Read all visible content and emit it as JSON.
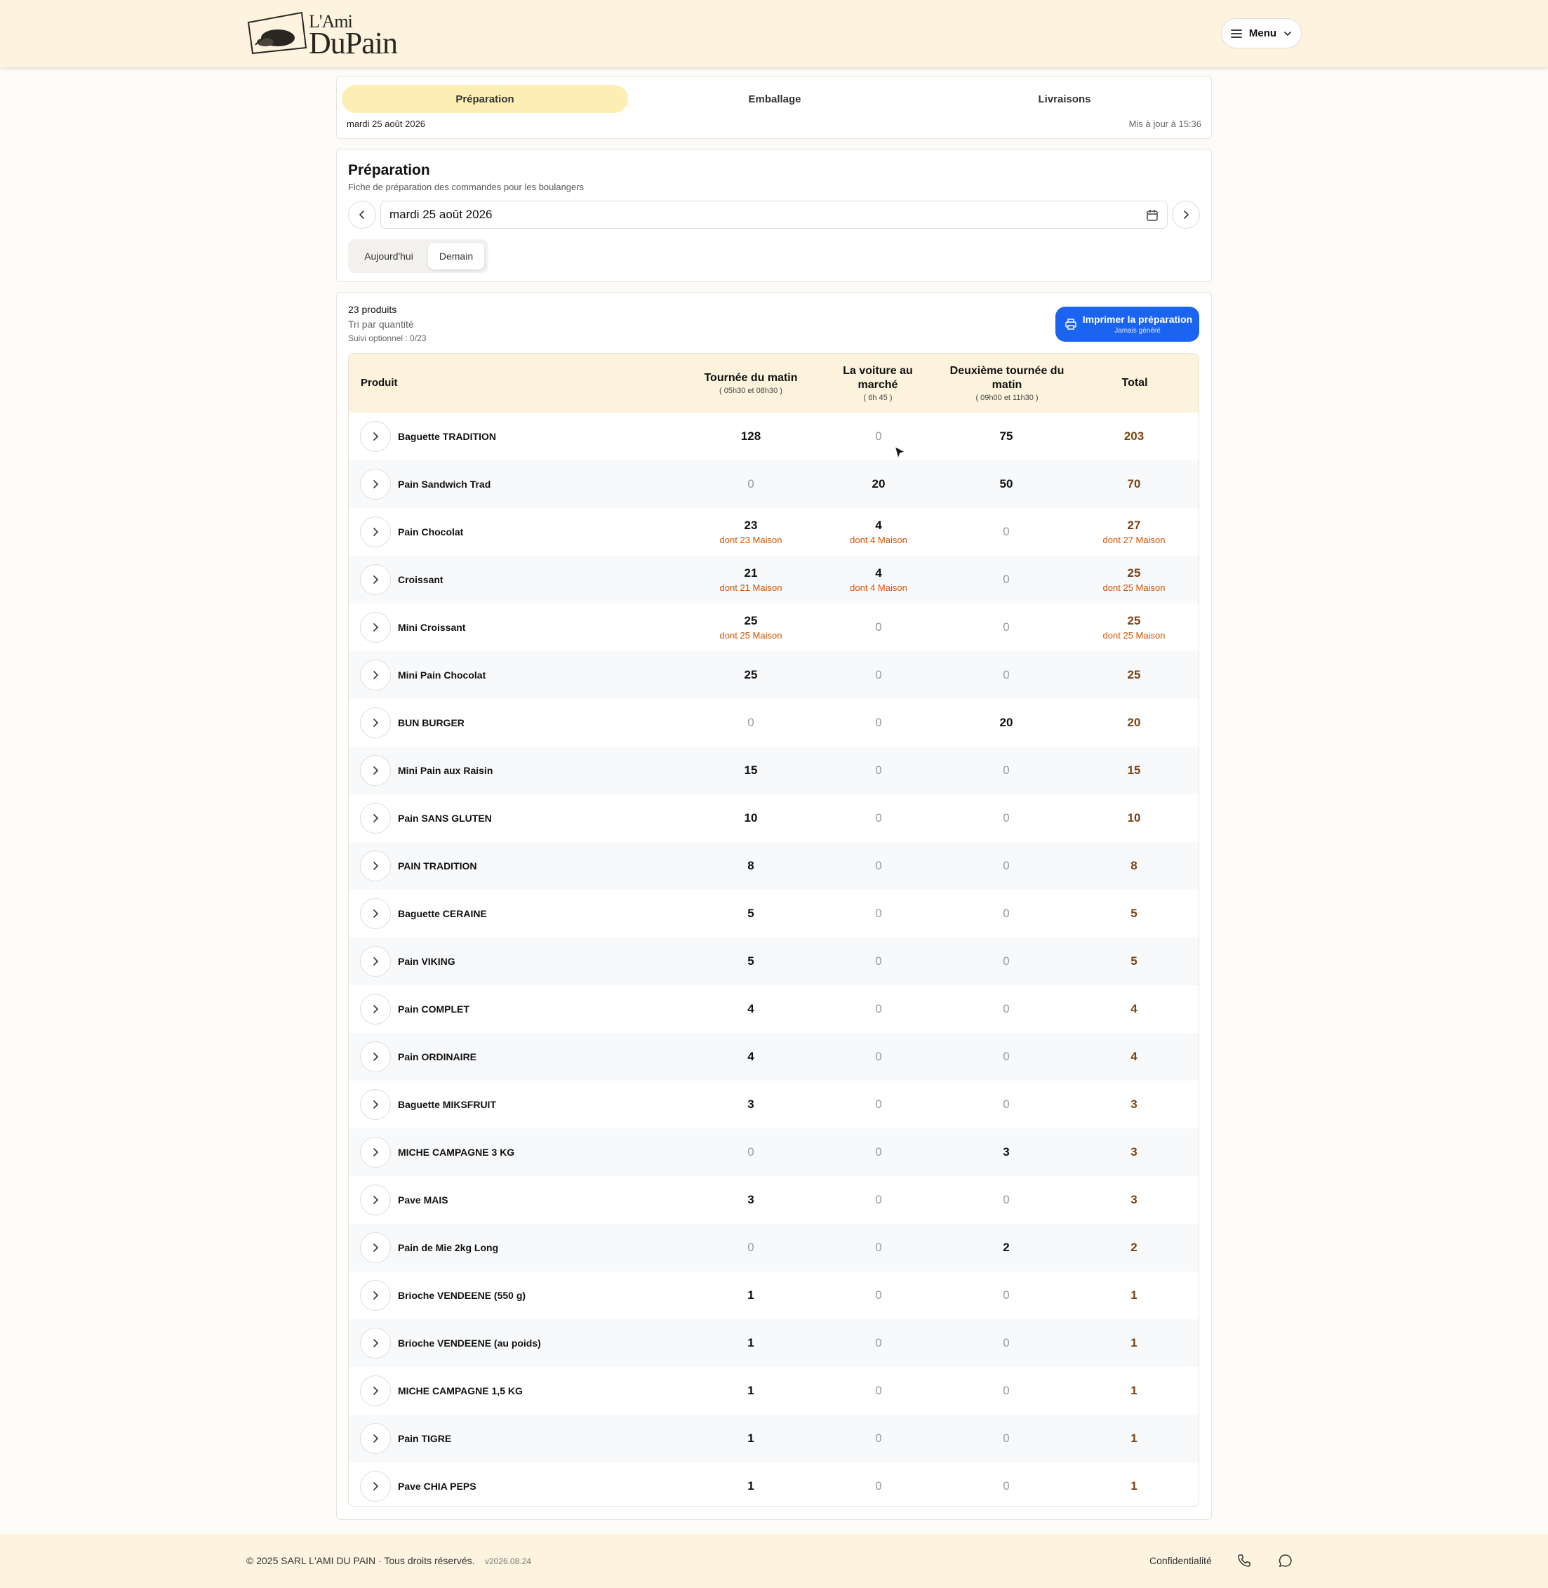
{
  "header": {
    "logo": {
      "line1": "L'Ami",
      "line2": "DuPain"
    },
    "menu_label": "Menu"
  },
  "tabs": [
    {
      "label": "Préparation",
      "active": true
    },
    {
      "label": "Emballage",
      "active": false
    },
    {
      "label": "Livraisons",
      "active": false
    }
  ],
  "tabs_meta": {
    "date": "mardi 25 août 2026",
    "updated": "Mis à jour à 15:36"
  },
  "preparation": {
    "title": "Préparation",
    "subtitle": "Fiche de préparation des commandes pour les boulangers",
    "date_value": "mardi 25 août 2026",
    "quick": [
      {
        "label": "Aujourd'hui",
        "active": false
      },
      {
        "label": "Demain",
        "active": true
      }
    ]
  },
  "summary": {
    "count": "23 produits",
    "sort": "Tri par quantité",
    "follow": "Suivi optionnel : 0/23"
  },
  "print_button": {
    "label": "Imprimer la préparation",
    "sub": "Jamais généré"
  },
  "table": {
    "columns": [
      {
        "title": "Produit",
        "sub": ""
      },
      {
        "title": "Tournée du matin",
        "sub": "( 05h30 et 08h30 )"
      },
      {
        "title": "La voiture au marché",
        "sub": "( 6h 45 )"
      },
      {
        "title": "Deuxième tournée du matin",
        "sub": "( 09h00 et 11h30 )"
      },
      {
        "title": "Total",
        "sub": ""
      }
    ],
    "rows": [
      {
        "name": "Baguette TRADITION",
        "v": [
          128,
          0,
          75,
          203
        ],
        "m": [
          "",
          "",
          "",
          ""
        ]
      },
      {
        "name": "Pain Sandwich Trad",
        "v": [
          0,
          20,
          50,
          70
        ],
        "m": [
          "",
          "",
          "",
          ""
        ]
      },
      {
        "name": "Pain Chocolat",
        "v": [
          23,
          4,
          0,
          27
        ],
        "m": [
          "dont 23 Maison",
          "dont 4 Maison",
          "",
          "dont 27 Maison"
        ]
      },
      {
        "name": "Croissant",
        "v": [
          21,
          4,
          0,
          25
        ],
        "m": [
          "dont 21 Maison",
          "dont 4 Maison",
          "",
          "dont 25 Maison"
        ]
      },
      {
        "name": "Mini Croissant",
        "v": [
          25,
          0,
          0,
          25
        ],
        "m": [
          "dont 25 Maison",
          "",
          "",
          "dont 25 Maison"
        ]
      },
      {
        "name": "Mini Pain Chocolat",
        "v": [
          25,
          0,
          0,
          25
        ],
        "m": [
          "",
          "",
          "",
          ""
        ]
      },
      {
        "name": "BUN BURGER",
        "v": [
          0,
          0,
          20,
          20
        ],
        "m": [
          "",
          "",
          "",
          ""
        ]
      },
      {
        "name": "Mini Pain aux Raisin",
        "v": [
          15,
          0,
          0,
          15
        ],
        "m": [
          "",
          "",
          "",
          ""
        ]
      },
      {
        "name": "Pain SANS GLUTEN",
        "v": [
          10,
          0,
          0,
          10
        ],
        "m": [
          "",
          "",
          "",
          ""
        ]
      },
      {
        "name": "PAIN TRADITION",
        "v": [
          8,
          0,
          0,
          8
        ],
        "m": [
          "",
          "",
          "",
          ""
        ]
      },
      {
        "name": "Baguette CERAINE",
        "v": [
          5,
          0,
          0,
          5
        ],
        "m": [
          "",
          "",
          "",
          ""
        ]
      },
      {
        "name": "Pain VIKING",
        "v": [
          5,
          0,
          0,
          5
        ],
        "m": [
          "",
          "",
          "",
          ""
        ]
      },
      {
        "name": "Pain COMPLET",
        "v": [
          4,
          0,
          0,
          4
        ],
        "m": [
          "",
          "",
          "",
          ""
        ]
      },
      {
        "name": "Pain ORDINAIRE",
        "v": [
          4,
          0,
          0,
          4
        ],
        "m": [
          "",
          "",
          "",
          ""
        ]
      },
      {
        "name": "Baguette MIKSFRUIT",
        "v": [
          3,
          0,
          0,
          3
        ],
        "m": [
          "",
          "",
          "",
          ""
        ]
      },
      {
        "name": "MICHE CAMPAGNE 3 KG",
        "v": [
          0,
          0,
          3,
          3
        ],
        "m": [
          "",
          "",
          "",
          ""
        ]
      },
      {
        "name": "Pave MAIS",
        "v": [
          3,
          0,
          0,
          3
        ],
        "m": [
          "",
          "",
          "",
          ""
        ]
      },
      {
        "name": "Pain de Mie 2kg Long",
        "v": [
          0,
          0,
          2,
          2
        ],
        "m": [
          "",
          "",
          "",
          ""
        ]
      },
      {
        "name": "Brioche VENDEENE (550 g)",
        "v": [
          1,
          0,
          0,
          1
        ],
        "m": [
          "",
          "",
          "",
          ""
        ]
      },
      {
        "name": "Brioche VENDEENE (au poids)",
        "v": [
          1,
          0,
          0,
          1
        ],
        "m": [
          "",
          "",
          "",
          ""
        ]
      },
      {
        "name": "MICHE CAMPAGNE 1,5 KG",
        "v": [
          1,
          0,
          0,
          1
        ],
        "m": [
          "",
          "",
          "",
          ""
        ]
      },
      {
        "name": "Pain TIGRE",
        "v": [
          1,
          0,
          0,
          1
        ],
        "m": [
          "",
          "",
          "",
          ""
        ]
      },
      {
        "name": "Pave CHIA PEPS",
        "v": [
          1,
          0,
          0,
          1
        ],
        "m": [
          "",
          "",
          "",
          ""
        ]
      }
    ]
  },
  "footer": {
    "copyright": "© 2025 SARL L'AMI DU PAIN · Tous droits réservés.",
    "version": "v2026.08.24",
    "privacy": "Confidentialité"
  },
  "colors": {
    "accent": "#1b64f1",
    "tab_active": "#fdefb4",
    "header_bg": "#fdf3de",
    "maison": "#d35400",
    "total": "#7a4310"
  }
}
